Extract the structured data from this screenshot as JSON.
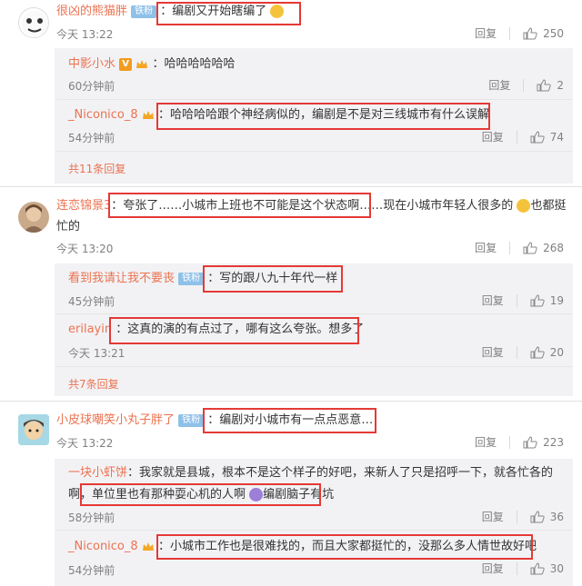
{
  "comments": [
    {
      "name": "很凶的熊猫胖",
      "badge": "铁粉",
      "text": "：编剧又开始瞎编了",
      "time": "今天 13:22",
      "reply_label": "回复",
      "likes": "250",
      "replies": [
        {
          "name": "中影小水",
          "text": "：哈哈哈哈哈哈",
          "time": "60分钟前",
          "reply_label": "回复",
          "likes": "2"
        },
        {
          "name": "_Niconico_8",
          "text": "：哈哈哈哈跟个神经病似的，编剧是不是对三线城市有什么误解",
          "time": "54分钟前",
          "reply_label": "回复",
          "likes": "74"
        }
      ],
      "more": "共11条回复"
    },
    {
      "name": "连恋锦景3",
      "text": "：夸张了……小城市上班也不可能是这个状态啊……现在小城市年轻人很多的",
      "text2": "也都挺",
      "text3": "忙的",
      "time": "今天 13:20",
      "reply_label": "回复",
      "likes": "268",
      "replies": [
        {
          "name": "看到我请让我不要丧",
          "badge": "铁粉",
          "text": "：写的跟八九十年代一样",
          "time": "45分钟前",
          "reply_label": "回复",
          "likes": "19"
        },
        {
          "name": "erilayin",
          "text": "：这真的演的有点过了，哪有这么夸张。想多了",
          "time": "今天 13:21",
          "reply_label": "回复",
          "likes": "20"
        }
      ],
      "more": "共7条回复"
    },
    {
      "name": "小皮球嘲笑小丸子胖了",
      "badge": "铁粉",
      "text": "：编剧对小城市有一点点恶意…",
      "time": "今天 13:22",
      "reply_label": "回复",
      "likes": "223",
      "replies": [
        {
          "name": "一块小虾饼",
          "text": "：我家就是县城，根本不是这个样子的好吧，来新人了只是招呼一下，就各忙各的",
          "text2": "啊，单位里也有那种耍心机的人啊",
          "text3": "编剧脑子有坑",
          "time": "58分钟前",
          "reply_label": "回复",
          "likes": "36"
        },
        {
          "name": "_Niconico_8",
          "text": "：小城市工作也是很难找的，而且大家都挺忙的，没那么多人情世故好吧",
          "time": "54分钟前",
          "reply_label": "回复",
          "likes": "30"
        }
      ]
    }
  ],
  "colors": {
    "name": "#eb7350",
    "highlight_box": "#e53935",
    "reply_bg": "#f2f2f5"
  }
}
